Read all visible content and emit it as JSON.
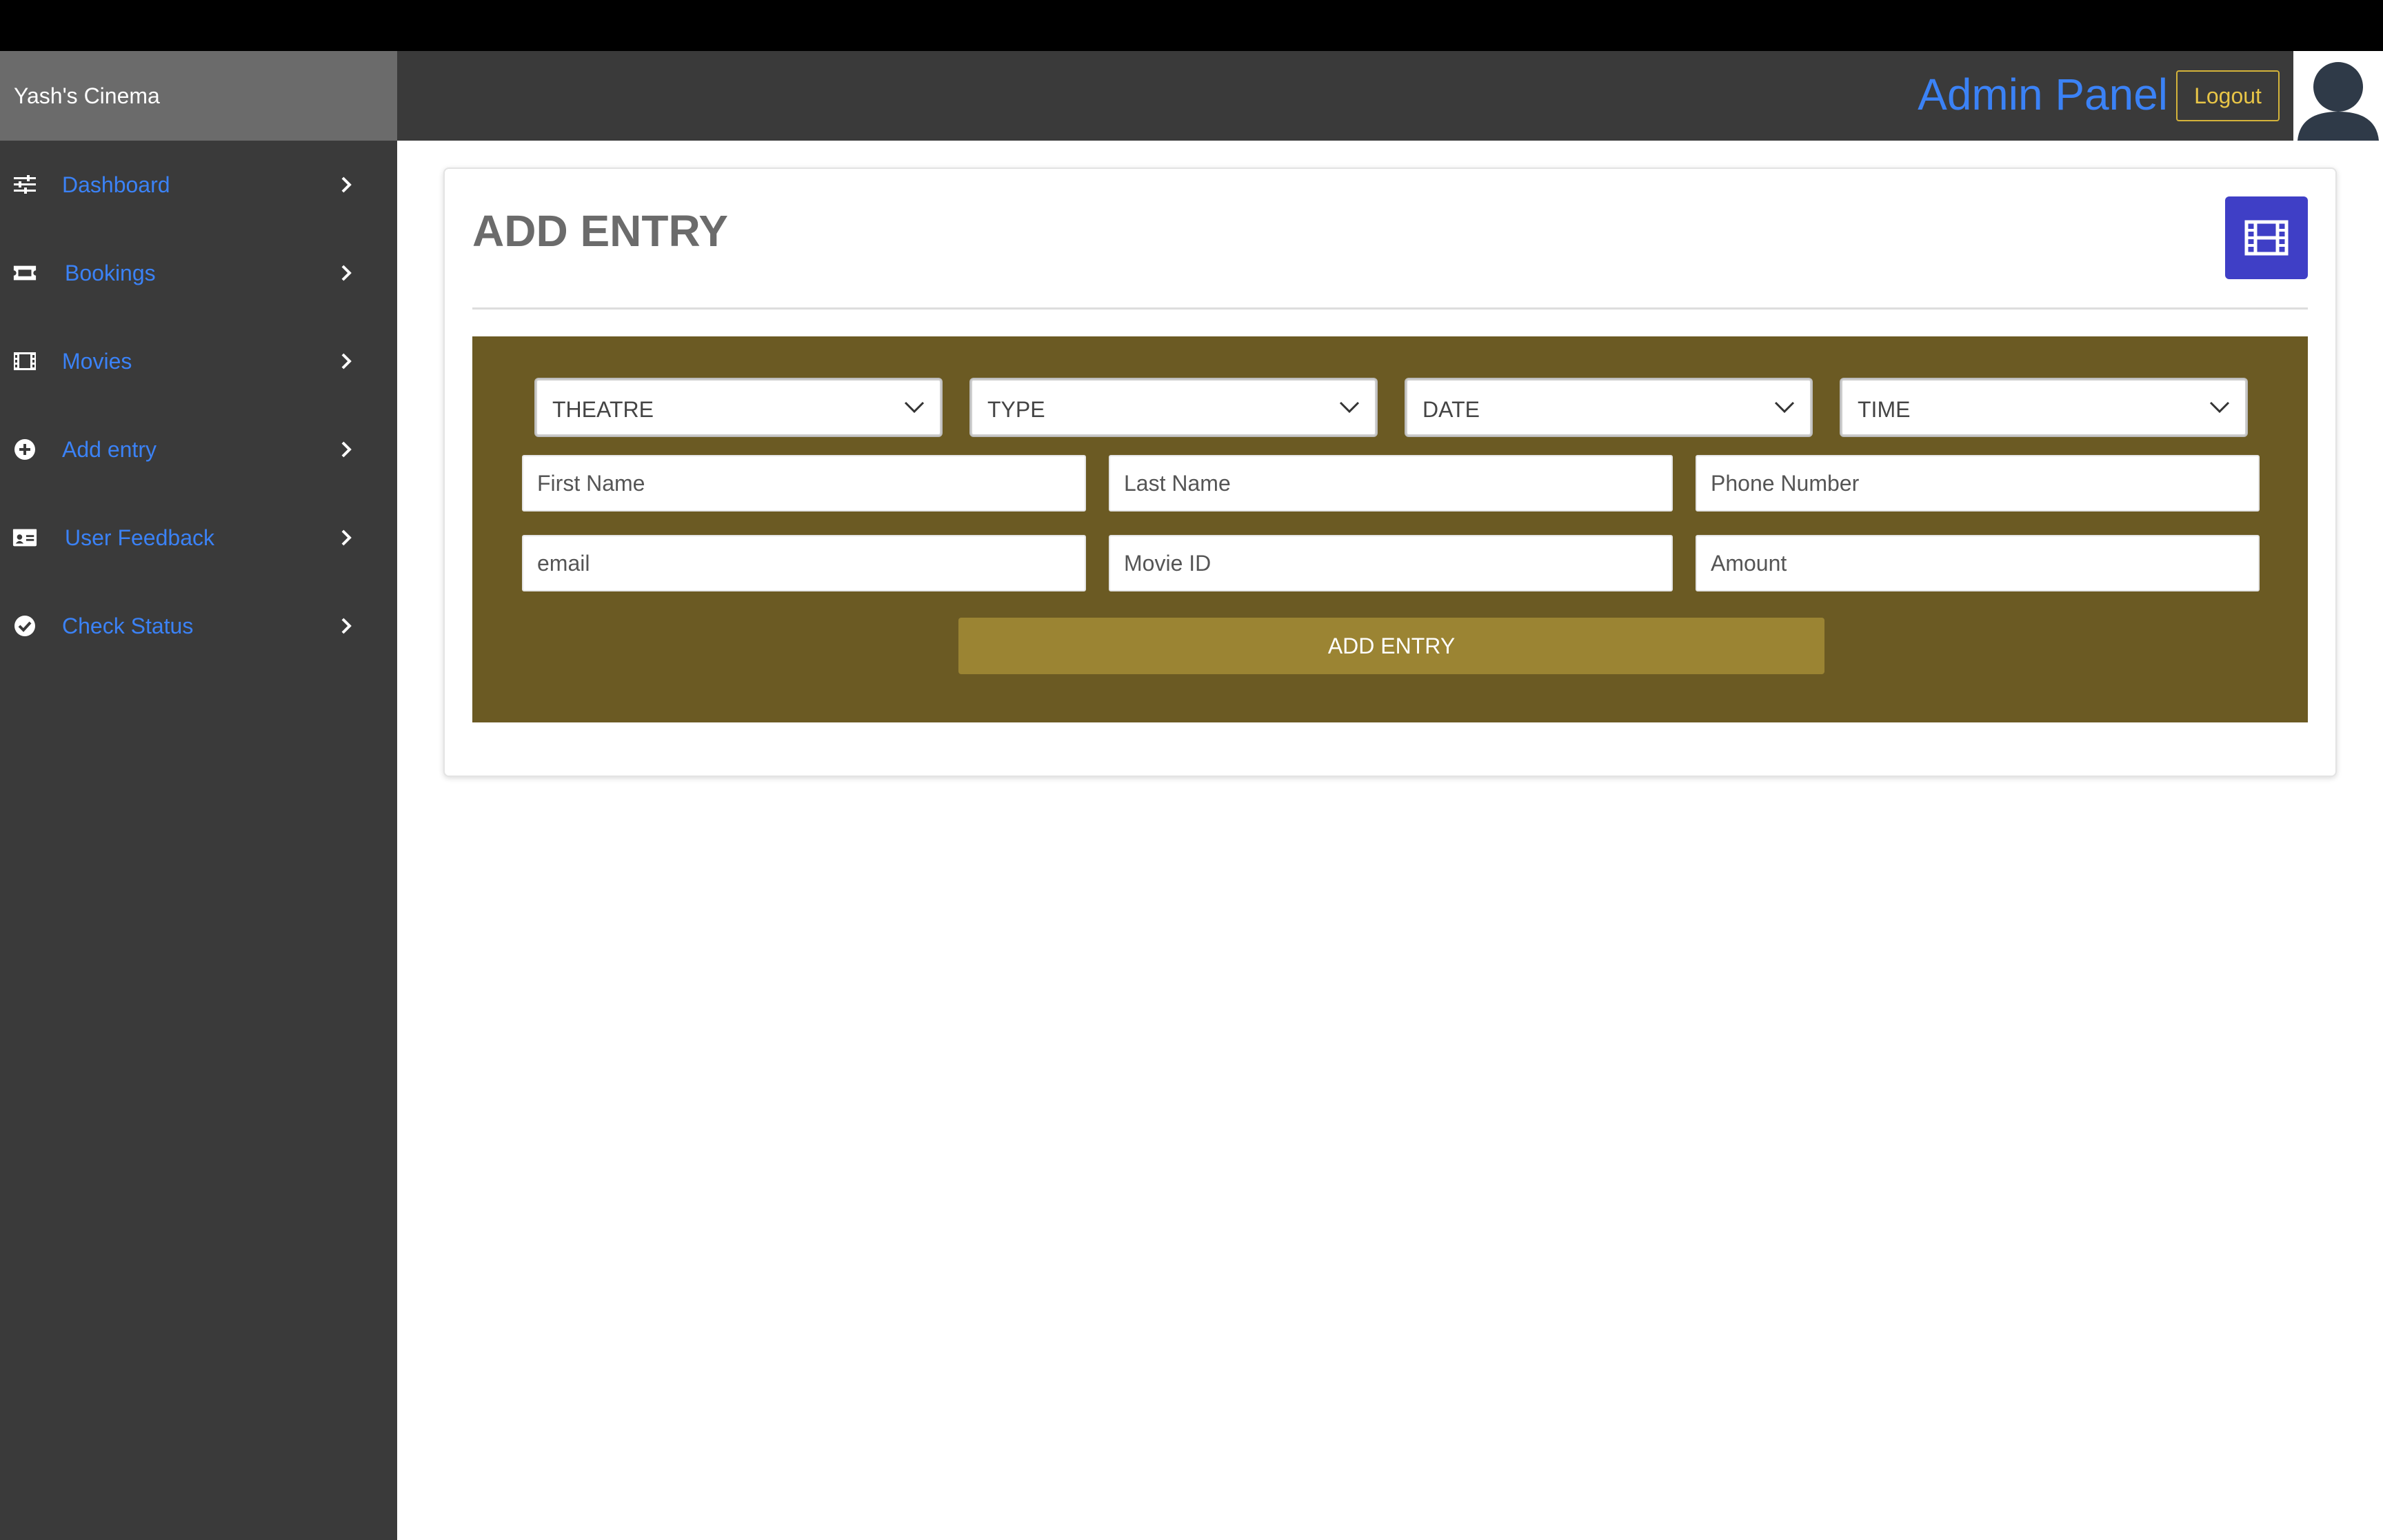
{
  "app": {
    "brand": "Yash's Cinema"
  },
  "sidebar": {
    "items": [
      {
        "label": "Dashboard",
        "icon": "sliders-icon"
      },
      {
        "label": "Bookings",
        "icon": "ticket-icon"
      },
      {
        "label": "Movies",
        "icon": "film-icon"
      },
      {
        "label": "Add entry",
        "icon": "plus-circle-icon"
      },
      {
        "label": "User Feedback",
        "icon": "id-card-icon"
      },
      {
        "label": "Check Status",
        "icon": "check-circle-icon"
      }
    ]
  },
  "header": {
    "title": "Admin Panel",
    "logout_label": "Logout"
  },
  "main": {
    "title": "ADD ENTRY",
    "selects": [
      {
        "label": "THEATRE"
      },
      {
        "label": "TYPE"
      },
      {
        "label": "DATE"
      },
      {
        "label": "TIME"
      }
    ],
    "inputs": {
      "first_name": {
        "placeholder": "First Name",
        "value": ""
      },
      "last_name": {
        "placeholder": "Last Name",
        "value": ""
      },
      "phone": {
        "placeholder": "Phone Number",
        "value": ""
      },
      "email": {
        "placeholder": "email",
        "value": ""
      },
      "movie_id": {
        "placeholder": "Movie ID",
        "value": ""
      },
      "amount": {
        "placeholder": "Amount",
        "value": ""
      }
    },
    "submit_label": "ADD ENTRY"
  },
  "colors": {
    "accent_blue": "#3b82f6",
    "panel_brown": "#6b5a23",
    "button_gold": "#9b8433",
    "logout_gold": "#e8c547",
    "film_button": "#3f3fc6",
    "sidebar_bg": "#3a3a3a"
  }
}
